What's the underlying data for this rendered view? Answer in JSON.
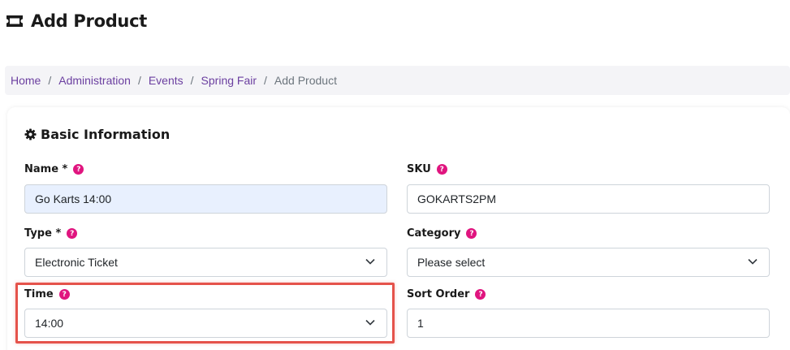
{
  "page": {
    "title": "Add Product"
  },
  "breadcrumb": {
    "items": [
      "Home",
      "Administration",
      "Events",
      "Spring Fair"
    ],
    "current": "Add Product",
    "separator": "/"
  },
  "section": {
    "title": "Basic Information"
  },
  "fields": {
    "name": {
      "label": "Name *",
      "value": "Go Karts 14:00"
    },
    "sku": {
      "label": "SKU",
      "value": "GOKARTS2PM"
    },
    "type": {
      "label": "Type *",
      "value": "Electronic Ticket"
    },
    "category": {
      "label": "Category",
      "value": "Please select"
    },
    "time": {
      "label": "Time",
      "value": "14:00"
    },
    "sort_order": {
      "label": "Sort Order",
      "value": "1"
    }
  },
  "help_glyph": "?",
  "icons": {
    "title": "ticket-icon",
    "section": "gear-icon",
    "help": "help-icon",
    "dropdown": "chevron-down-icon"
  },
  "colors": {
    "link": "#6b3fa0",
    "help_badge": "#e0157f",
    "highlight": "#e5534b",
    "autofill_bg": "#e8f0fe"
  }
}
